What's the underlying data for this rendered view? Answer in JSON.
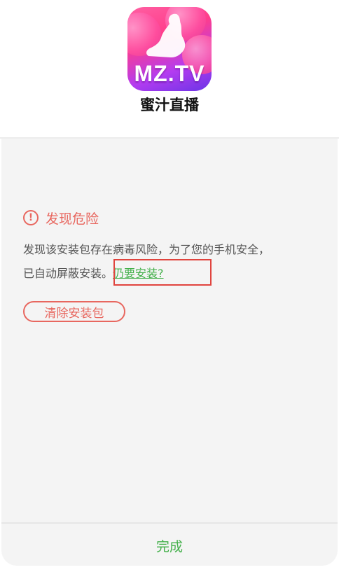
{
  "header": {
    "app_icon": {
      "brand_text": "MZ.TV",
      "icon_name": "mz-tv-app-icon"
    },
    "app_name": "蜜汁直播"
  },
  "warning": {
    "icon_name": "exclamation-circle-icon",
    "title": "发现危险",
    "message_line1": "发现该安装包存在病毒风险，为了您的手机安全，",
    "message_line2": "已自动屏蔽安装。",
    "link_label": "仍要安装?"
  },
  "actions": {
    "clear_label": "清除安装包",
    "done_label": "完成"
  },
  "colors": {
    "warning": "#e8675f",
    "link": "#43b04a",
    "highlight_box": "#e0443e",
    "panel_background": "#f4f4f4"
  }
}
